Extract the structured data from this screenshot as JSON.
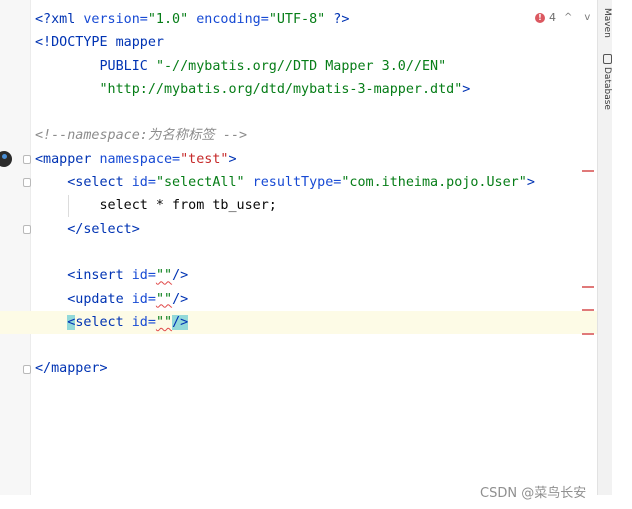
{
  "editor": {
    "lines": [
      {
        "segments": [
          [
            "tag",
            "<?xml "
          ],
          [
            "attr",
            "version="
          ],
          [
            "val",
            "\"1.0\""
          ],
          [
            "attr",
            " encoding="
          ],
          [
            "val",
            "\"UTF-8\""
          ],
          [
            "tag",
            " ?>"
          ]
        ]
      },
      {
        "segments": [
          [
            "tag",
            "<!DOCTYPE mapper"
          ]
        ]
      },
      {
        "segments": [
          [
            "tag",
            "        PUBLIC "
          ],
          [
            "val",
            "\"-//mybatis.org//DTD Mapper 3.0//EN\""
          ]
        ]
      },
      {
        "segments": [
          [
            "val",
            "        \"http://mybatis.org/dtd/mybatis-3-mapper.dtd\""
          ],
          [
            "tag",
            ">"
          ]
        ]
      },
      {
        "segments": []
      },
      {
        "segments": [
          [
            "cm",
            "<!--namespace:为名称标签 -->"
          ]
        ]
      },
      {
        "segments": [
          [
            "tag",
            "<mapper "
          ],
          [
            "attr",
            "namespace="
          ],
          [
            "red",
            "\"test\""
          ],
          [
            "tag",
            ">"
          ]
        ]
      },
      {
        "segments": [
          [
            "tag",
            "    <select "
          ],
          [
            "attr",
            "id="
          ],
          [
            "val",
            "\"selectAll\""
          ],
          [
            "attr",
            " resultType="
          ],
          [
            "val",
            "\"com.itheima.pojo.User\""
          ],
          [
            "tag",
            ">"
          ]
        ]
      },
      {
        "segments": [
          [
            "plain",
            "        select * from tb_user;"
          ]
        ]
      },
      {
        "segments": [
          [
            "tag",
            "    </select>"
          ]
        ]
      },
      {
        "segments": []
      },
      {
        "segments": [
          [
            "tag",
            "    <insert "
          ],
          [
            "attr",
            "id="
          ],
          [
            "val_err",
            "\"\""
          ],
          [
            "tag",
            "/>"
          ]
        ]
      },
      {
        "segments": [
          [
            "tag",
            "    <update "
          ],
          [
            "attr",
            "id="
          ],
          [
            "val_err",
            "\"\""
          ],
          [
            "tag",
            "/>"
          ]
        ]
      },
      {
        "segments": [
          [
            "plain",
            "    "
          ],
          [
            "tag_hl",
            "<"
          ],
          [
            "tag",
            "select "
          ],
          [
            "attr",
            "id="
          ],
          [
            "val_err",
            "\"\""
          ],
          [
            "tag_hl",
            "/>"
          ]
        ],
        "current": true
      },
      {
        "segments": []
      },
      {
        "segments": [
          [
            "tag",
            "</mapper>"
          ]
        ]
      }
    ]
  },
  "inspections": {
    "error_count": "4",
    "up_arrow": "^",
    "down_arrow": "v"
  },
  "tool_window": {
    "maven_label": "Maven",
    "database_label": "Database"
  },
  "watermark": "CSDN @菜鸟长安"
}
